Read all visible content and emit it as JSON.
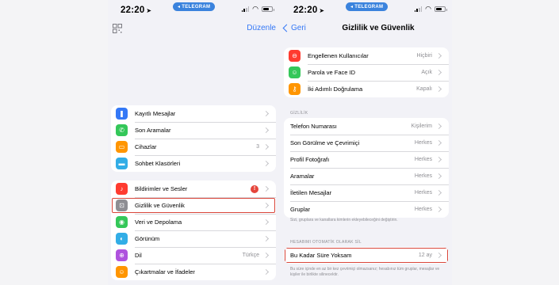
{
  "status": {
    "time": "22:20",
    "location_arrow": "➤",
    "pill": "TELEGRAM"
  },
  "left": {
    "edit_label": "Düzenle",
    "group1": [
      {
        "label": "Kayıtlı Mesajlar",
        "icon": "bookmark-icon",
        "color": "#3478f6",
        "glyph": "❚"
      },
      {
        "label": "Son Aramalar",
        "icon": "phone-icon",
        "color": "#34c759",
        "glyph": "✆"
      },
      {
        "label": "Cihazlar",
        "icon": "devices-icon",
        "color": "#ff9500",
        "glyph": "▭",
        "value": "3"
      },
      {
        "label": "Sohbet Klasörleri",
        "icon": "folder-icon",
        "color": "#32ade6",
        "glyph": "▬"
      }
    ],
    "group2": [
      {
        "label": "Bildirimler ve Sesler",
        "icon": "bell-icon",
        "color": "#ff3b30",
        "glyph": "♪",
        "badge": "!"
      },
      {
        "label": "Gizlilik ve Güvenlik",
        "icon": "lock-icon",
        "color": "#8e8e93",
        "glyph": "⊡"
      },
      {
        "label": "Veri ve Depolama",
        "icon": "database-icon",
        "color": "#34c759",
        "glyph": "◉"
      },
      {
        "label": "Görünüm",
        "icon": "appearance-icon",
        "color": "#32ade6",
        "glyph": "◐"
      },
      {
        "label": "Dil",
        "icon": "globe-icon",
        "color": "#af52de",
        "glyph": "⊕",
        "value": "Türkçe"
      },
      {
        "label": "Çıkartmalar ve İfadeler",
        "icon": "sticker-icon",
        "color": "#ff9500",
        "glyph": "☺"
      }
    ]
  },
  "right": {
    "back_label": "Geri",
    "title": "Gizlilik ve Güvenlik",
    "group1": [
      {
        "label": "Engellenen Kullanıcılar",
        "icon": "block-icon",
        "color": "#ff3b30",
        "glyph": "⊖",
        "value": "Hiçbiri"
      },
      {
        "label": "Parola ve Face ID",
        "icon": "faceid-icon",
        "color": "#34c759",
        "glyph": "☺",
        "value": "Açık"
      },
      {
        "label": "İki Adımlı Doğrulama",
        "icon": "key-icon",
        "color": "#ff9500",
        "glyph": "⚷",
        "value": "Kapalı"
      }
    ],
    "privacy_header": "GİZLİLİK",
    "group2": [
      {
        "label": "Telefon Numarası",
        "value": "Kişilerim"
      },
      {
        "label": "Son Görülme ve Çevrimiçi",
        "value": "Herkes"
      },
      {
        "label": "Profil Fotoğrafı",
        "value": "Herkes"
      },
      {
        "label": "Aramalar",
        "value": "Herkes"
      },
      {
        "label": "İletilen Mesajlar",
        "value": "Herkes"
      },
      {
        "label": "Gruplar",
        "value": "Herkes"
      }
    ],
    "privacy_footer": "Sizi, gruplara ve kanallara kimlerin ekleyebileceğini değiştirin.",
    "auto_delete_header": "HESABIMI OTOMATİK OLARAK SİL",
    "group3": [
      {
        "label": "Bu Kadar Süre Yoksam",
        "value": "12 ay"
      }
    ],
    "auto_delete_footer": "Bu süre içinde en az bir kez çevrimiçi olmazsanız; hesabınız tüm gruplar, mesajlar ve kişiler ile birlikte silinecektir."
  }
}
